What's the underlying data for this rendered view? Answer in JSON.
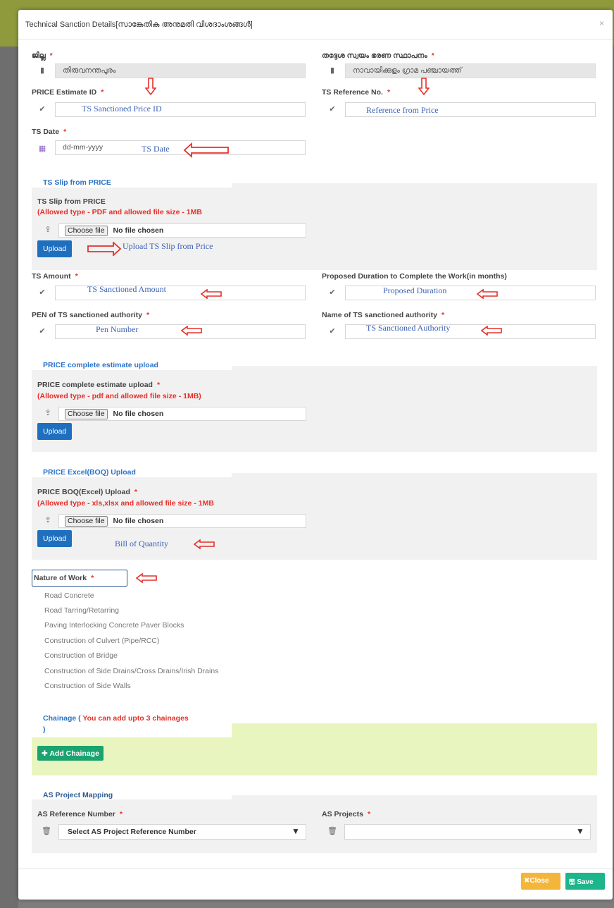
{
  "modal": {
    "title": "Technical Sanction Details[സാങ്കേതിക അനുമതി വിശദാംശങ്ങൾ]",
    "close_icon": "×"
  },
  "fields": {
    "district": {
      "label": "ജില്ല",
      "value": "തിരുവനന്തപുരം"
    },
    "lsg": {
      "label": "തദ്ദേശ സ്വയം ഭരണ സ്ഥാപനം",
      "value": "നാവായിക്കുളം ഗ്രാമ പഞ്ചായത്ത്"
    },
    "price_estimate_id": {
      "label": "PRICE Estimate ID",
      "annotation": "TS Sanctioned Price ID"
    },
    "ts_reference_no": {
      "label": "TS Reference No.",
      "annotation": "Reference from Price"
    },
    "ts_date": {
      "label": "TS Date",
      "placeholder": "dd-mm-yyyy",
      "annotation": "TS Date"
    },
    "ts_amount": {
      "label": "TS Amount",
      "annotation": "TS Sanctioned Amount"
    },
    "proposed_duration": {
      "label": "Proposed Duration to Complete the Work(in months)",
      "annotation": "Proposed Duration"
    },
    "pen": {
      "label": "PEN of TS sanctioned authority",
      "annotation": "Pen Number"
    },
    "authority_name": {
      "label": "Name of TS sanctioned authority",
      "annotation": "TS Sanctioned Authority"
    },
    "required_mark": "*"
  },
  "file_input": {
    "choose_label": "Choose file",
    "no_file_label": "No file chosen"
  },
  "sections": {
    "ts_slip": {
      "title": "TS Slip from PRICE",
      "field_label": "TS Slip from PRICE",
      "note": "(Allowed type - PDF and allowed file size - 1MB",
      "upload_label": "Upload",
      "annotation": "Upload TS Slip from Price"
    },
    "complete_estimate": {
      "title": "PRICE complete estimate upload",
      "field_label": "PRICE complete estimate upload",
      "note": "(Allowed type - pdf and allowed file size - 1MB)",
      "upload_label": "Upload"
    },
    "boq": {
      "title": "PRICE Excel(BOQ) Upload",
      "field_label": "PRICE BOQ(Excel) Upload",
      "note": "(Allowed type - xls,xlsx and allowed file size - 1MB",
      "upload_label": "Upload",
      "annotation": "Bill of Quantity"
    },
    "chainage": {
      "title": "Chainage (",
      "title_note": "You can add upto 3 chainages",
      "title_close": ")",
      "add_label": "Add Chainage"
    },
    "as_mapping": {
      "title": "AS Project Mapping",
      "ref_label": "AS Reference Number",
      "ref_placeholder": "Select AS Project Reference Number",
      "projects_label": "AS Projects"
    }
  },
  "nature_of_work": {
    "label": "Nature of Work",
    "items": [
      "Road Concrete",
      "Road Tarring/Retarring",
      "Paving Interlocking Concrete Paver Blocks",
      "Construction of Culvert (Pipe/RCC)",
      "Construction of Bridge",
      "Construction of Side Drains/Cross Drains/Irish Drains",
      "Construction of Side Walls"
    ]
  },
  "footer": {
    "close_label": "Close",
    "save_label": "Save"
  },
  "colors": {
    "primary": "#1f6fbf",
    "required": "#e5302a",
    "section_title": "#2a72c9",
    "chainage_bg": "#e9f5bf",
    "close": "#f4b63a",
    "save": "#1db58b"
  }
}
